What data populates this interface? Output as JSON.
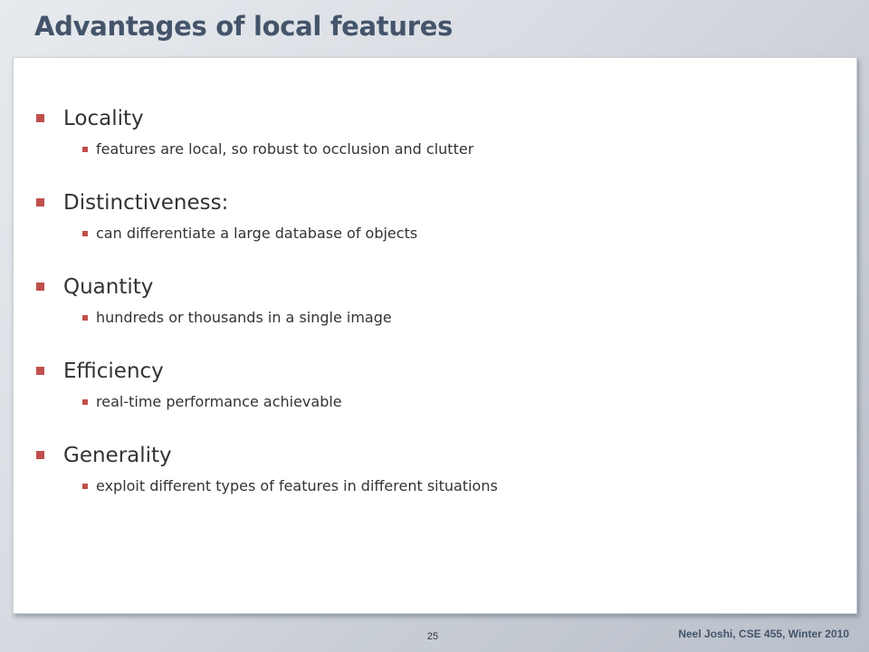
{
  "slide": {
    "title": "Advantages of local features",
    "bullets": [
      {
        "text": "Locality",
        "sub": "features are local, so robust to occlusion and clutter"
      },
      {
        "text": "Distinctiveness:",
        "sub": "can differentiate a large database of objects"
      },
      {
        "text": "Quantity",
        "sub": "hundreds or thousands in a single image"
      },
      {
        "text": "Efficiency",
        "sub": "real-time performance achievable"
      },
      {
        "text": "Generality",
        "sub": "exploit different types of features in different situations"
      }
    ],
    "page_number": "25",
    "footer": "Neel Joshi, CSE 455, Winter 2010"
  },
  "colors": {
    "title": "#44546a",
    "bullet_marker": "#c0504d",
    "body_text": "#333333",
    "panel_background": "#ffffff"
  },
  "icons": {
    "bullet_marker": "square-bullet-icon"
  }
}
